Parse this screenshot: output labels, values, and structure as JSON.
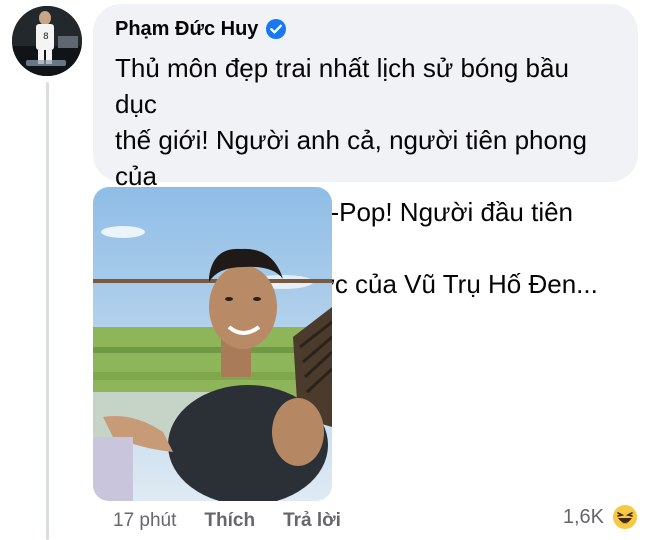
{
  "comment": {
    "author": "Phạm Đức Huy",
    "text": "Thủ môn đẹp trai nhất lịch sử bóng bầu dục\nthế giới! Người anh cả, người tiên phong của\nnhững nam thần K-Pop! Người đầu tiên đạt\nđến hằng đẳng thức của Vũ Trụ Hố Đen..."
  },
  "actions": {
    "time": "17 phút",
    "like_label": "Thích",
    "reply_label": "Trả lời"
  },
  "reactions": {
    "count": "1,6K",
    "icon": "haha-emoji-icon"
  },
  "colors": {
    "bubble_bg": "#f0f2f5",
    "verified_blue": "#1877f2",
    "secondary_text": "#65676b"
  }
}
